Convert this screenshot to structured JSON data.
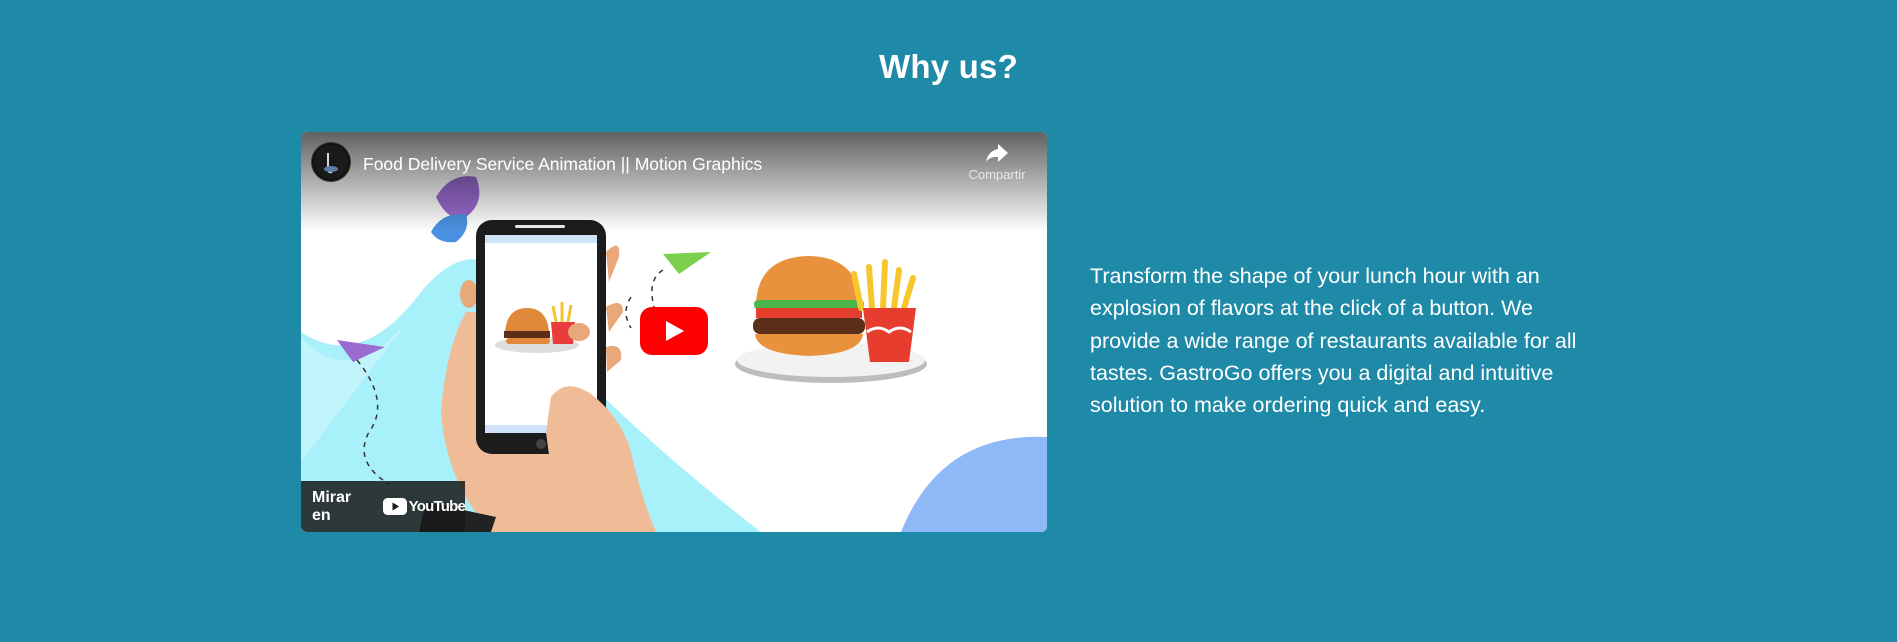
{
  "section": {
    "title": "Why us?",
    "description": "Transform the shape of your lunch hour with an explosion of flavors at the click of a button. We provide a wide range of restaurants available for all tastes. GastroGo offers you a digital and intuitive solution to make ordering quick and easy."
  },
  "video": {
    "title": "Food Delivery Service Animation || Motion Graphics",
    "share_label": "Compartir",
    "watch_on_label": "Mirar en",
    "platform_logo_text": "YouTube"
  },
  "colors": {
    "background": "#1e8aa7",
    "play_button": "#ff0000",
    "text": "#ffffff"
  }
}
